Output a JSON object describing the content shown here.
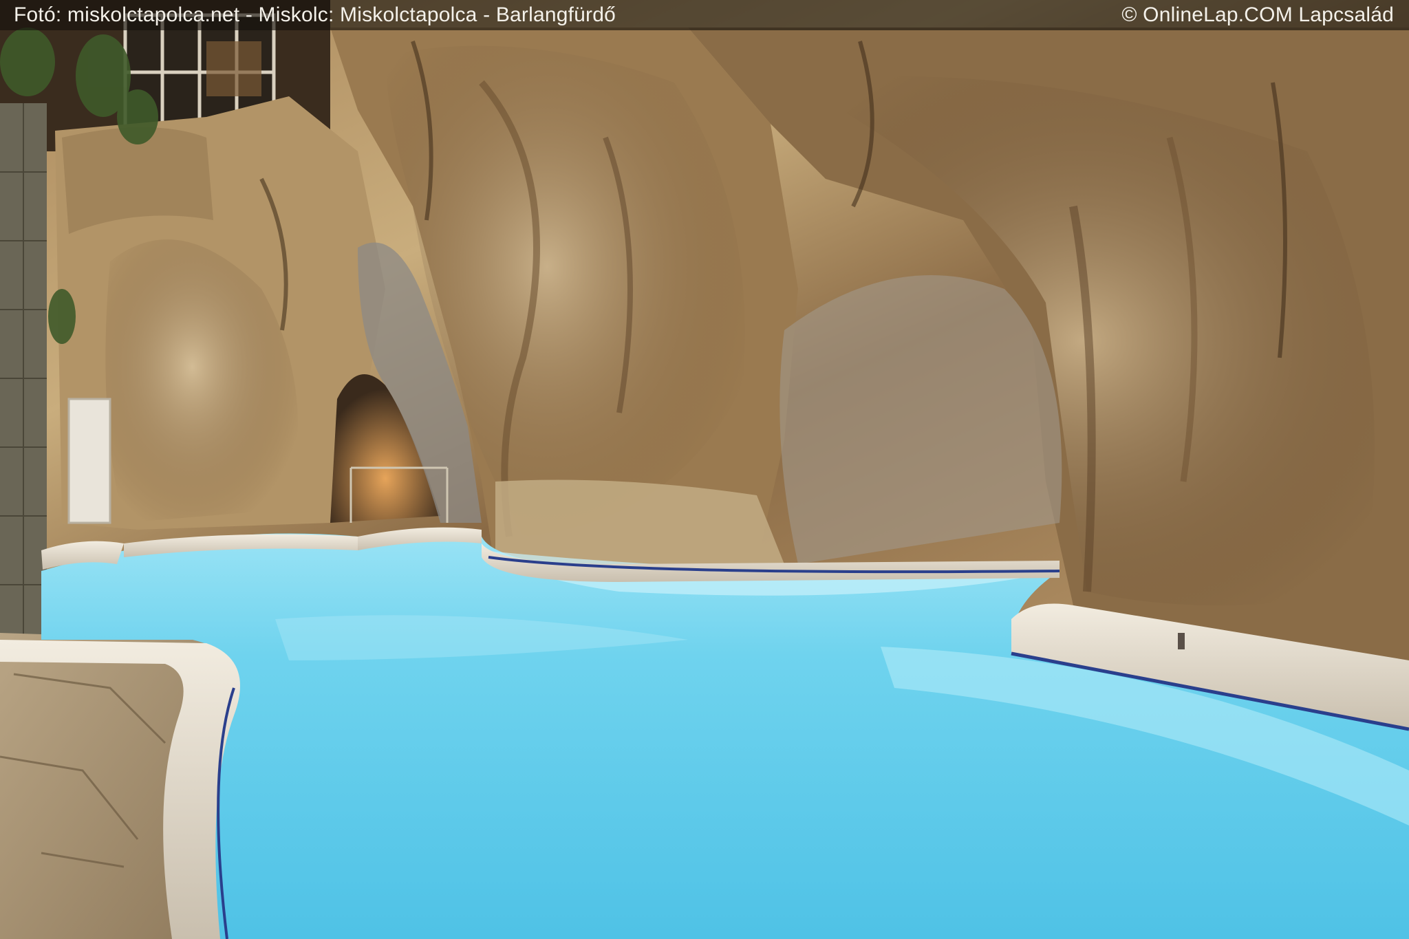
{
  "caption": {
    "left": "Fotó: miskolctapolca.net - Miskolc:  Miskolctapolca - Barlangfürdő",
    "right": "© OnlineLap.COM  Lapcsalád"
  },
  "colors": {
    "rock_light": "#d2b98c",
    "rock_dark": "#5a4128",
    "water": "#6fd3ee",
    "caption_bar": "#14100c"
  }
}
